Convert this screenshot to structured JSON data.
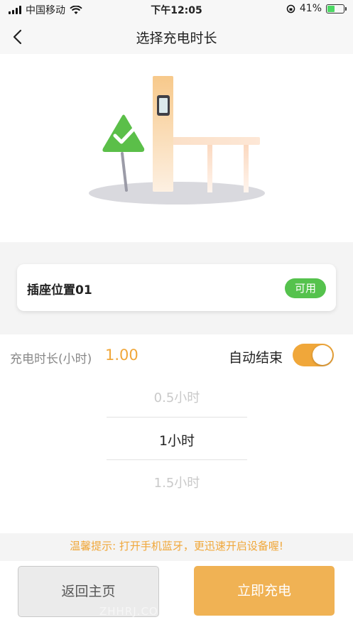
{
  "status_bar": {
    "carrier": "中国移动",
    "time": "下午12:05",
    "battery": "41%"
  },
  "nav": {
    "title": "选择充电时长"
  },
  "socket": {
    "name": "插座位置01",
    "status": "可用"
  },
  "duration": {
    "label": "充电时长(小时)",
    "value": "1.00",
    "auto_end_label": "自动结束",
    "auto_end_enabled": true,
    "options": [
      "0.5小时",
      "1小时",
      "1.5小时"
    ],
    "selected_index": 1
  },
  "tip": "温馨提示: 打开手机蓝牙，更迅速开启设备喔!",
  "buttons": {
    "home": "返回主页",
    "charge": "立即充电"
  },
  "watermark": "ZHHRJ.COM",
  "colors": {
    "accent": "#f0a73a",
    "available": "#55c24d"
  }
}
